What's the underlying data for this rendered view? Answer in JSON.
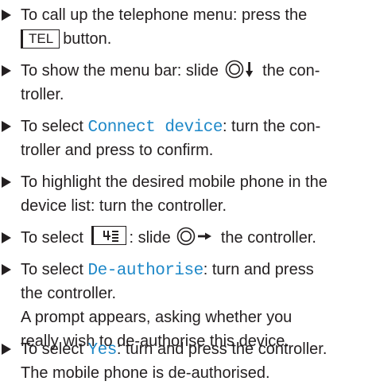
{
  "steps": [
    {
      "pre": "To call up the telephone menu: press the",
      "key": "TEL",
      "post": "button."
    },
    {
      "pre": "To show the menu bar: slide",
      "post_line1": "the con-",
      "line2": "troller."
    },
    {
      "pre": "To select",
      "highlight": "Connect device",
      "post_line1": ": turn the con-",
      "line2": "troller and press to confirm."
    },
    {
      "line1": "To highlight the desired mobile phone in the",
      "line2": "device list: turn the controller."
    },
    {
      "pre": "To select",
      "post": ": slide",
      "end": "the controller."
    },
    {
      "pre": "To select",
      "highlight": "De-authorise",
      "post_line1": ": turn and press",
      "line2": "the controller.",
      "line3": "A prompt appears, asking whether you",
      "line4": "really wish to de-authorise this device."
    },
    {
      "pre": "To select",
      "highlight": "Yes",
      "post_line1": ": turn and press the controller.",
      "line2": "The mobile phone is de-authorised."
    }
  ],
  "colors": {
    "text": "#231f20",
    "highlight": "#1e88c8"
  },
  "icons": [
    "step-bullet-icon",
    "controller-slide-down-icon",
    "controller-slide-right-icon",
    "phone-book-button-icon"
  ]
}
